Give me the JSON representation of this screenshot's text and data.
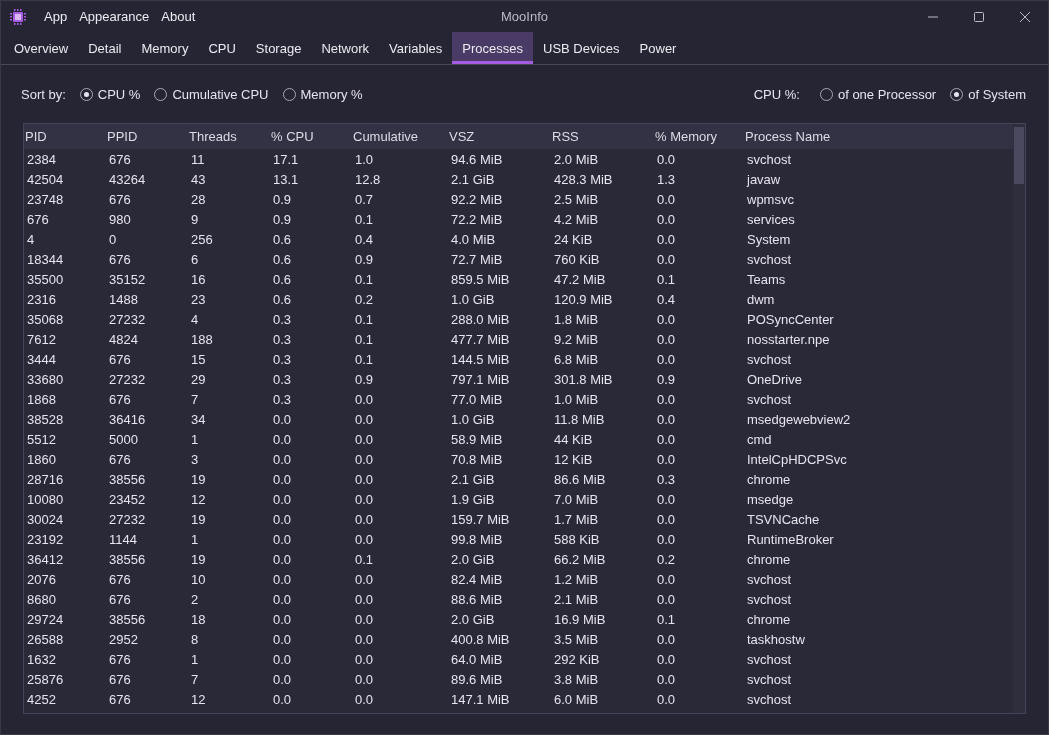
{
  "window": {
    "title": "MooInfo",
    "menu": [
      "App",
      "Appearance",
      "About"
    ]
  },
  "tabs": [
    {
      "label": "Overview",
      "selected": false
    },
    {
      "label": "Detail",
      "selected": false
    },
    {
      "label": "Memory",
      "selected": false
    },
    {
      "label": "CPU",
      "selected": false
    },
    {
      "label": "Storage",
      "selected": false
    },
    {
      "label": "Network",
      "selected": false
    },
    {
      "label": "Variables",
      "selected": false
    },
    {
      "label": "Processes",
      "selected": true
    },
    {
      "label": "USB Devices",
      "selected": false
    },
    {
      "label": "Power",
      "selected": false
    }
  ],
  "sort": {
    "label": "Sort by:",
    "options": [
      {
        "label": "CPU %",
        "selected": true
      },
      {
        "label": "Cumulative CPU",
        "selected": false
      },
      {
        "label": "Memory %",
        "selected": false
      }
    ]
  },
  "cpu_mode": {
    "label": "CPU %:",
    "options": [
      {
        "label": "of one Processor",
        "selected": false
      },
      {
        "label": "of System",
        "selected": true
      }
    ]
  },
  "table": {
    "columns": [
      "PID",
      "PPID",
      "Threads",
      "% CPU",
      "Cumulative",
      "VSZ",
      "RSS",
      "% Memory",
      "Process Name"
    ],
    "rows": [
      [
        "2384",
        "676",
        "11",
        "17.1",
        "1.0",
        "94.6 MiB",
        "2.0 MiB",
        "0.0",
        "svchost"
      ],
      [
        "42504",
        "43264",
        "43",
        "13.1",
        "12.8",
        "2.1 GiB",
        "428.3 MiB",
        "1.3",
        "javaw"
      ],
      [
        "23748",
        "676",
        "28",
        "0.9",
        "0.7",
        "92.2 MiB",
        "2.5 MiB",
        "0.0",
        "wpmsvc"
      ],
      [
        "676",
        "980",
        "9",
        "0.9",
        "0.1",
        "72.2 MiB",
        "4.2 MiB",
        "0.0",
        "services"
      ],
      [
        "4",
        "0",
        "256",
        "0.6",
        "0.4",
        "4.0 MiB",
        "24 KiB",
        "0.0",
        "System"
      ],
      [
        "18344",
        "676",
        "6",
        "0.6",
        "0.9",
        "72.7 MiB",
        "760 KiB",
        "0.0",
        "svchost"
      ],
      [
        "35500",
        "35152",
        "16",
        "0.6",
        "0.1",
        "859.5 MiB",
        "47.2 MiB",
        "0.1",
        "Teams"
      ],
      [
        "2316",
        "1488",
        "23",
        "0.6",
        "0.2",
        "1.0 GiB",
        "120.9 MiB",
        "0.4",
        "dwm"
      ],
      [
        "35068",
        "27232",
        "4",
        "0.3",
        "0.1",
        "288.0 MiB",
        "1.8 MiB",
        "0.0",
        "POSyncCenter"
      ],
      [
        "7612",
        "4824",
        "188",
        "0.3",
        "0.1",
        "477.7 MiB",
        "9.2 MiB",
        "0.0",
        "nosstarter.npe"
      ],
      [
        "3444",
        "676",
        "15",
        "0.3",
        "0.1",
        "144.5 MiB",
        "6.8 MiB",
        "0.0",
        "svchost"
      ],
      [
        "33680",
        "27232",
        "29",
        "0.3",
        "0.9",
        "797.1 MiB",
        "301.8 MiB",
        "0.9",
        "OneDrive"
      ],
      [
        "1868",
        "676",
        "7",
        "0.3",
        "0.0",
        "77.0 MiB",
        "1.0 MiB",
        "0.0",
        "svchost"
      ],
      [
        "38528",
        "36416",
        "34",
        "0.0",
        "0.0",
        "1.0 GiB",
        "11.8 MiB",
        "0.0",
        "msedgewebview2"
      ],
      [
        "5512",
        "5000",
        "1",
        "0.0",
        "0.0",
        "58.9 MiB",
        "44 KiB",
        "0.0",
        "cmd"
      ],
      [
        "1860",
        "676",
        "3",
        "0.0",
        "0.0",
        "70.8 MiB",
        "12 KiB",
        "0.0",
        "IntelCpHDCPSvc"
      ],
      [
        "28716",
        "38556",
        "19",
        "0.0",
        "0.0",
        "2.1 GiB",
        "86.6 MiB",
        "0.3",
        "chrome"
      ],
      [
        "10080",
        "23452",
        "12",
        "0.0",
        "0.0",
        "1.9 GiB",
        "7.0 MiB",
        "0.0",
        "msedge"
      ],
      [
        "30024",
        "27232",
        "19",
        "0.0",
        "0.0",
        "159.7 MiB",
        "1.7 MiB",
        "0.0",
        "TSVNCache"
      ],
      [
        "23192",
        "1144",
        "1",
        "0.0",
        "0.0",
        "99.8 MiB",
        "588 KiB",
        "0.0",
        "RuntimeBroker"
      ],
      [
        "36412",
        "38556",
        "19",
        "0.0",
        "0.1",
        "2.0 GiB",
        "66.2 MiB",
        "0.2",
        "chrome"
      ],
      [
        "2076",
        "676",
        "10",
        "0.0",
        "0.0",
        "82.4 MiB",
        "1.2 MiB",
        "0.0",
        "svchost"
      ],
      [
        "8680",
        "676",
        "2",
        "0.0",
        "0.0",
        "88.6 MiB",
        "2.1 MiB",
        "0.0",
        "svchost"
      ],
      [
        "29724",
        "38556",
        "18",
        "0.0",
        "0.0",
        "2.0 GiB",
        "16.9 MiB",
        "0.1",
        "chrome"
      ],
      [
        "26588",
        "2952",
        "8",
        "0.0",
        "0.0",
        "400.8 MiB",
        "3.5 MiB",
        "0.0",
        "taskhostw"
      ],
      [
        "1632",
        "676",
        "1",
        "0.0",
        "0.0",
        "64.0 MiB",
        "292 KiB",
        "0.0",
        "svchost"
      ],
      [
        "25876",
        "676",
        "7",
        "0.0",
        "0.0",
        "89.6 MiB",
        "3.8 MiB",
        "0.0",
        "svchost"
      ],
      [
        "4252",
        "676",
        "12",
        "0.0",
        "0.0",
        "147.1 MiB",
        "6.0 MiB",
        "0.0",
        "svchost"
      ]
    ]
  }
}
